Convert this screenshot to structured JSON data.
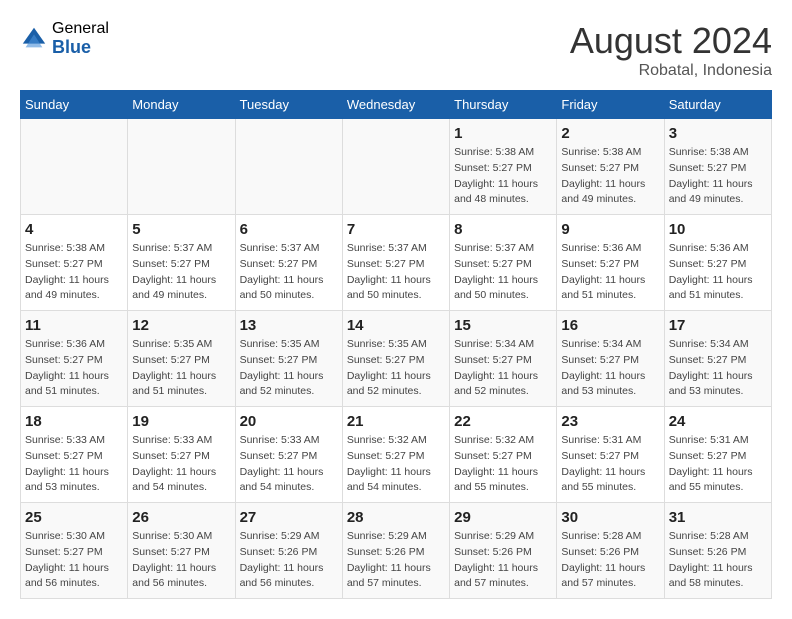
{
  "header": {
    "logo_general": "General",
    "logo_blue": "Blue",
    "month_year": "August 2024",
    "location": "Robatal, Indonesia"
  },
  "calendar": {
    "weekdays": [
      "Sunday",
      "Monday",
      "Tuesday",
      "Wednesday",
      "Thursday",
      "Friday",
      "Saturday"
    ],
    "weeks": [
      [
        {
          "day": "",
          "info": ""
        },
        {
          "day": "",
          "info": ""
        },
        {
          "day": "",
          "info": ""
        },
        {
          "day": "",
          "info": ""
        },
        {
          "day": "1",
          "info": "Sunrise: 5:38 AM\nSunset: 5:27 PM\nDaylight: 11 hours\nand 48 minutes."
        },
        {
          "day": "2",
          "info": "Sunrise: 5:38 AM\nSunset: 5:27 PM\nDaylight: 11 hours\nand 49 minutes."
        },
        {
          "day": "3",
          "info": "Sunrise: 5:38 AM\nSunset: 5:27 PM\nDaylight: 11 hours\nand 49 minutes."
        }
      ],
      [
        {
          "day": "4",
          "info": "Sunrise: 5:38 AM\nSunset: 5:27 PM\nDaylight: 11 hours\nand 49 minutes."
        },
        {
          "day": "5",
          "info": "Sunrise: 5:37 AM\nSunset: 5:27 PM\nDaylight: 11 hours\nand 49 minutes."
        },
        {
          "day": "6",
          "info": "Sunrise: 5:37 AM\nSunset: 5:27 PM\nDaylight: 11 hours\nand 50 minutes."
        },
        {
          "day": "7",
          "info": "Sunrise: 5:37 AM\nSunset: 5:27 PM\nDaylight: 11 hours\nand 50 minutes."
        },
        {
          "day": "8",
          "info": "Sunrise: 5:37 AM\nSunset: 5:27 PM\nDaylight: 11 hours\nand 50 minutes."
        },
        {
          "day": "9",
          "info": "Sunrise: 5:36 AM\nSunset: 5:27 PM\nDaylight: 11 hours\nand 51 minutes."
        },
        {
          "day": "10",
          "info": "Sunrise: 5:36 AM\nSunset: 5:27 PM\nDaylight: 11 hours\nand 51 minutes."
        }
      ],
      [
        {
          "day": "11",
          "info": "Sunrise: 5:36 AM\nSunset: 5:27 PM\nDaylight: 11 hours\nand 51 minutes."
        },
        {
          "day": "12",
          "info": "Sunrise: 5:35 AM\nSunset: 5:27 PM\nDaylight: 11 hours\nand 51 minutes."
        },
        {
          "day": "13",
          "info": "Sunrise: 5:35 AM\nSunset: 5:27 PM\nDaylight: 11 hours\nand 52 minutes."
        },
        {
          "day": "14",
          "info": "Sunrise: 5:35 AM\nSunset: 5:27 PM\nDaylight: 11 hours\nand 52 minutes."
        },
        {
          "day": "15",
          "info": "Sunrise: 5:34 AM\nSunset: 5:27 PM\nDaylight: 11 hours\nand 52 minutes."
        },
        {
          "day": "16",
          "info": "Sunrise: 5:34 AM\nSunset: 5:27 PM\nDaylight: 11 hours\nand 53 minutes."
        },
        {
          "day": "17",
          "info": "Sunrise: 5:34 AM\nSunset: 5:27 PM\nDaylight: 11 hours\nand 53 minutes."
        }
      ],
      [
        {
          "day": "18",
          "info": "Sunrise: 5:33 AM\nSunset: 5:27 PM\nDaylight: 11 hours\nand 53 minutes."
        },
        {
          "day": "19",
          "info": "Sunrise: 5:33 AM\nSunset: 5:27 PM\nDaylight: 11 hours\nand 54 minutes."
        },
        {
          "day": "20",
          "info": "Sunrise: 5:33 AM\nSunset: 5:27 PM\nDaylight: 11 hours\nand 54 minutes."
        },
        {
          "day": "21",
          "info": "Sunrise: 5:32 AM\nSunset: 5:27 PM\nDaylight: 11 hours\nand 54 minutes."
        },
        {
          "day": "22",
          "info": "Sunrise: 5:32 AM\nSunset: 5:27 PM\nDaylight: 11 hours\nand 55 minutes."
        },
        {
          "day": "23",
          "info": "Sunrise: 5:31 AM\nSunset: 5:27 PM\nDaylight: 11 hours\nand 55 minutes."
        },
        {
          "day": "24",
          "info": "Sunrise: 5:31 AM\nSunset: 5:27 PM\nDaylight: 11 hours\nand 55 minutes."
        }
      ],
      [
        {
          "day": "25",
          "info": "Sunrise: 5:30 AM\nSunset: 5:27 PM\nDaylight: 11 hours\nand 56 minutes."
        },
        {
          "day": "26",
          "info": "Sunrise: 5:30 AM\nSunset: 5:27 PM\nDaylight: 11 hours\nand 56 minutes."
        },
        {
          "day": "27",
          "info": "Sunrise: 5:29 AM\nSunset: 5:26 PM\nDaylight: 11 hours\nand 56 minutes."
        },
        {
          "day": "28",
          "info": "Sunrise: 5:29 AM\nSunset: 5:26 PM\nDaylight: 11 hours\nand 57 minutes."
        },
        {
          "day": "29",
          "info": "Sunrise: 5:29 AM\nSunset: 5:26 PM\nDaylight: 11 hours\nand 57 minutes."
        },
        {
          "day": "30",
          "info": "Sunrise: 5:28 AM\nSunset: 5:26 PM\nDaylight: 11 hours\nand 57 minutes."
        },
        {
          "day": "31",
          "info": "Sunrise: 5:28 AM\nSunset: 5:26 PM\nDaylight: 11 hours\nand 58 minutes."
        }
      ]
    ]
  }
}
